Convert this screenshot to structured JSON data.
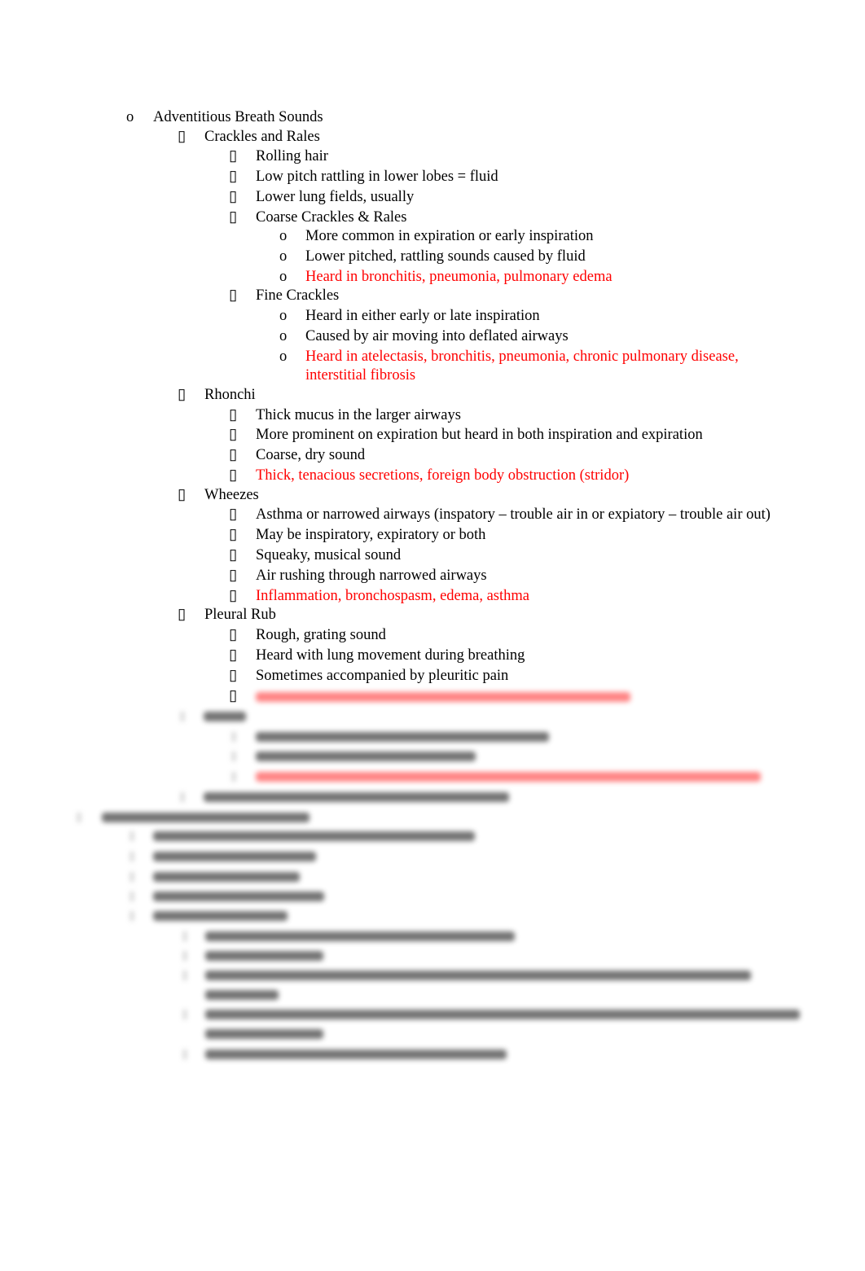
{
  "document": {
    "sections": [
      {
        "label": "Adventitious Breath Sounds",
        "bullet": "o",
        "items": [
          {
            "label": "Crackles and Rales",
            "bullet": "▯",
            "items": [
              {
                "label": "Rolling hair"
              },
              {
                "label": "Low pitch rattling in lower lobes = fluid"
              },
              {
                "label": "Lower lung fields, usually"
              },
              {
                "label": "Coarse Crackles & Rales",
                "items": [
                  {
                    "label": "More common in expiration or early inspiration"
                  },
                  {
                    "label": "Lower pitched, rattling sounds caused by fluid"
                  },
                  {
                    "label": "Heard in bronchitis, pneumonia, pulmonary edema",
                    "highlight": true
                  }
                ]
              },
              {
                "label": "Fine Crackles",
                "items": [
                  {
                    "label": "Heard in either early or late inspiration"
                  },
                  {
                    "label": "Caused by air moving into deflated airways"
                  },
                  {
                    "label": "Heard in atelectasis, bronchitis, pneumonia, chronic pulmonary disease,",
                    "label_cont": "interstitial fibrosis",
                    "highlight": true
                  }
                ]
              }
            ]
          },
          {
            "label": "Rhonchi",
            "items": [
              {
                "label": "Thick mucus in the larger airways"
              },
              {
                "label": "More prominent on expiration but heard in both inspiration and expiration"
              },
              {
                "label": "Coarse, dry sound"
              },
              {
                "label": "Thick, tenacious secretions, foreign body obstruction (stridor)",
                "highlight": true
              }
            ]
          },
          {
            "label": "Wheezes",
            "items": [
              {
                "label": "Asthma or narrowed airways (inspatory – trouble air in or expiatory – trouble air out)"
              },
              {
                "label": "May be inspiratory, expiratory or both"
              },
              {
                "label": "Squeaky, musical sound"
              },
              {
                "label": "Air rushing through narrowed airways"
              },
              {
                "label": "Inflammation, bronchospasm, edema, asthma",
                "highlight": true
              }
            ]
          },
          {
            "label": "Pleural Rub",
            "items": [
              {
                "label": "Rough, grating sound"
              },
              {
                "label": "Heard with lung movement during breathing"
              },
              {
                "label": "Sometimes accompanied by pleuritic pain"
              }
            ]
          }
        ]
      }
    ],
    "bullets": {
      "level1": "o",
      "level2": "▯",
      "level3": "▯",
      "level4": "o"
    },
    "blurred_note": "Remaining content obscured (preview blur)",
    "colors": {
      "text": "#000000",
      "highlight": "#ff0000"
    }
  }
}
